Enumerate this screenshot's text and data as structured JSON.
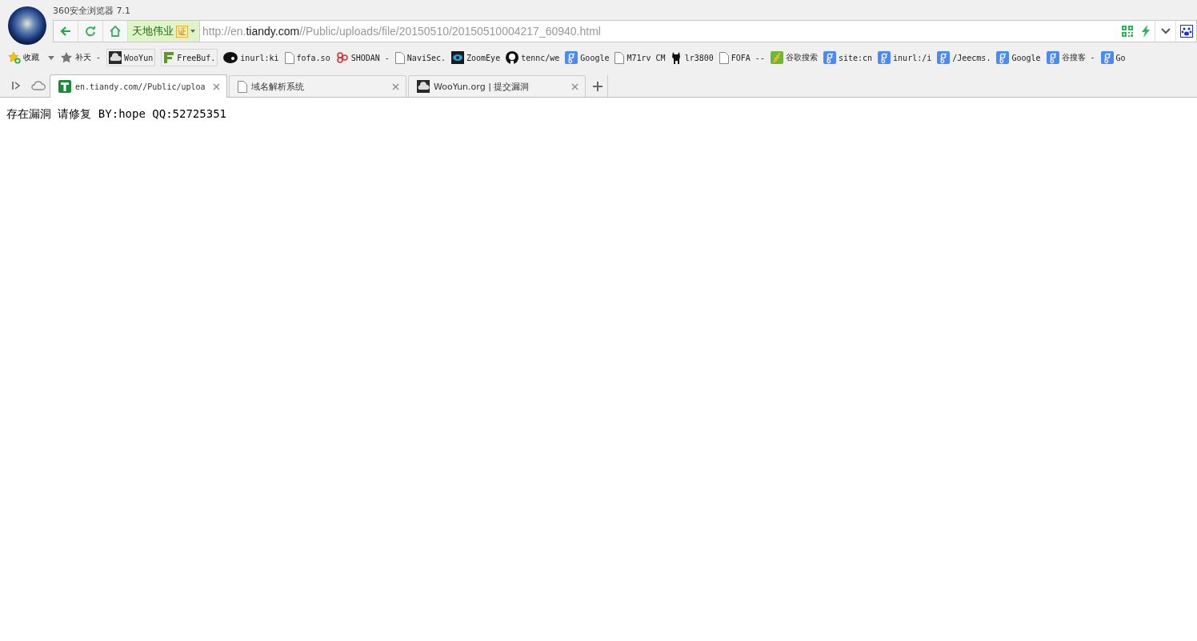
{
  "window": {
    "title": "360安全浏览器 7.1"
  },
  "address_bar": {
    "site_badge": "天地伟业",
    "cert_badge": "证",
    "url_prefix": "http://en.",
    "url_domain": "tiandy.com",
    "url_path": "//Public/uploads/file/20150510/20150510004217_60940.html"
  },
  "bookmarks": [
    {
      "kind": "favorites",
      "label": "收藏"
    },
    {
      "kind": "star",
      "label": "补天 -"
    },
    {
      "kind": "cloud",
      "label": "WooYun"
    },
    {
      "kind": "freebuf",
      "label": "FreeBuf."
    },
    {
      "kind": "aol",
      "label": "inurl:ki"
    },
    {
      "kind": "page",
      "label": "fofa.so"
    },
    {
      "kind": "shodan",
      "label": "SHODAN -"
    },
    {
      "kind": "page",
      "label": "NaviSec."
    },
    {
      "kind": "eye",
      "label": "ZoomEye"
    },
    {
      "kind": "github",
      "label": "tennc/we"
    },
    {
      "kind": "google",
      "label": "Google"
    },
    {
      "kind": "page",
      "label": "M71rv CM"
    },
    {
      "kind": "cat",
      "label": "lr3800"
    },
    {
      "kind": "page",
      "label": "FOFA --"
    },
    {
      "kind": "grain",
      "label": "谷歌搜索"
    },
    {
      "kind": "google",
      "label": "site:cn"
    },
    {
      "kind": "google",
      "label": "inurl:/i"
    },
    {
      "kind": "google",
      "label": "/Jeecms."
    },
    {
      "kind": "google",
      "label": "Google"
    },
    {
      "kind": "google",
      "label": "谷搜客 -"
    },
    {
      "kind": "google",
      "label": "Go"
    }
  ],
  "tabs": [
    {
      "kind": "tiandy",
      "title": "en.tiandy.com//Public/uploa",
      "selected": true
    },
    {
      "kind": "page",
      "title": "域名解析系统",
      "selected": false
    },
    {
      "kind": "cloud",
      "title": "WooYun.org | 提交漏洞",
      "selected": false
    }
  ],
  "page_text": "存在漏洞 请修复 BY:hope QQ:52725351"
}
